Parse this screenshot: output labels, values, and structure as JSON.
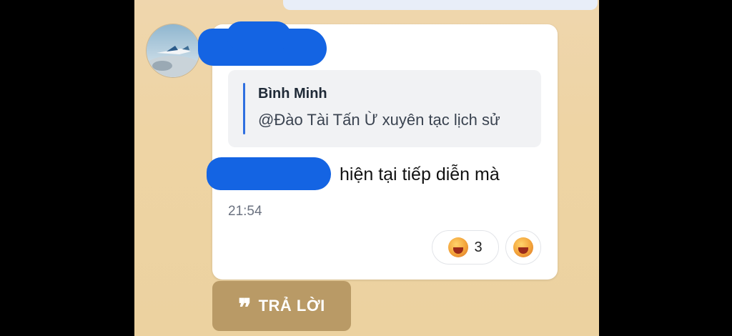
{
  "message": {
    "quote": {
      "author": "Bình Minh",
      "text": "@Đào Tài Tấn Ừ xuyên tạc lịch sử"
    },
    "text_visible": "hiện tại tiếp diễn mà",
    "time": "21:54",
    "reactions": [
      {
        "emoji": "crying-laughing-emoji",
        "count": "3"
      },
      {
        "emoji": "crying-laughing-emoji",
        "count": ""
      }
    ]
  },
  "actions": {
    "reply_label": "TRẢ LỜI",
    "reply_icon": "❞"
  },
  "colors": {
    "chat_background": "#eed4a4",
    "redaction": "#1464e3",
    "quote_bar": "#2f6fe0",
    "reply_button": "#b99a66"
  }
}
